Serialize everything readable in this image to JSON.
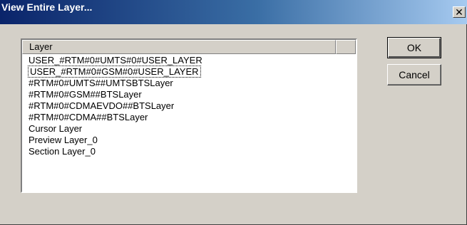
{
  "window": {
    "title": "View Entire Layer...",
    "close_glyph": "✕",
    "close_icon": "close-icon"
  },
  "list": {
    "column_header": "Layer",
    "items": [
      "USER_#RTM#0#UMTS#0#USER_LAYER",
      "USER_#RTM#0#GSM#0#USER_LAYER",
      "#RTM#0#UMTS##UMTSBTSLayer",
      "#RTM#0#GSM##BTSLayer",
      "#RTM#0#CDMAEVDO##BTSLayer",
      "#RTM#0#CDMA##BTSLayer",
      "Cursor Layer",
      "Preview Layer_0",
      "Section Layer_0"
    ],
    "focused_index": 1
  },
  "buttons": {
    "ok_label": "OK",
    "cancel_label": "Cancel"
  }
}
